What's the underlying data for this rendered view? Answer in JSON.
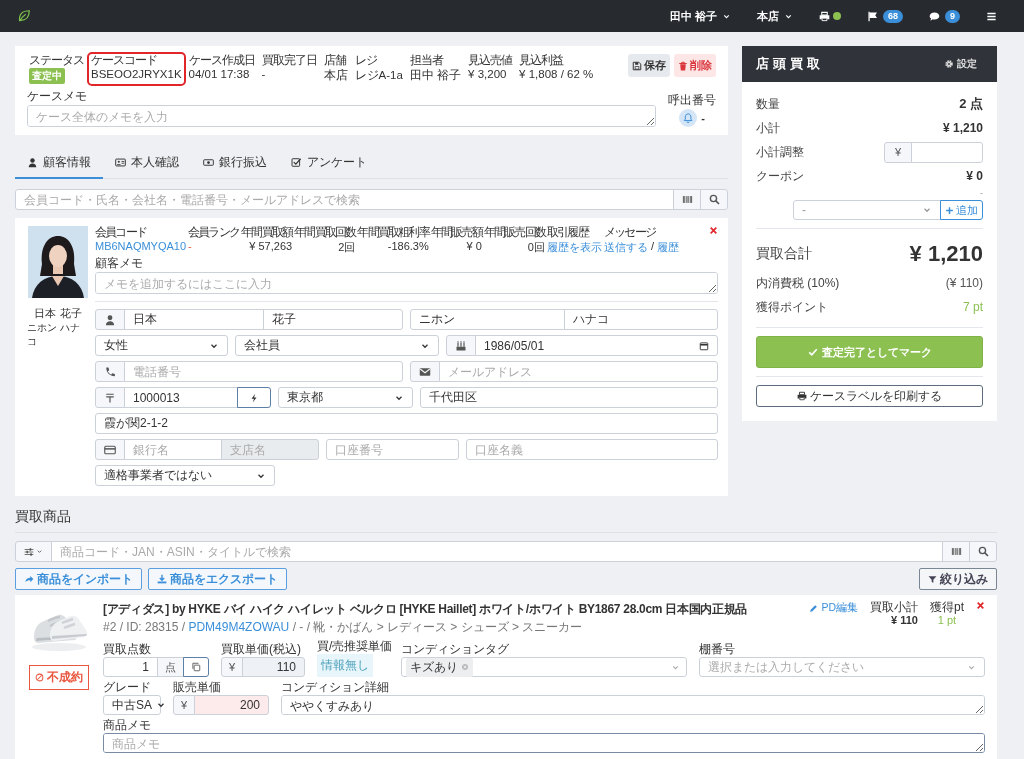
{
  "topbar": {
    "user": "田中 裕子",
    "store": "本店",
    "printer_online": true,
    "flags": "68",
    "messages": "9"
  },
  "case": {
    "fields": [
      {
        "label": "ステータス",
        "value": "査定中",
        "kind": "badge",
        "highlighted": false
      },
      {
        "label": "ケースコード",
        "value": "BSEOO2JRYX1K",
        "kind": "text",
        "highlighted": true
      },
      {
        "label": "ケース作成日",
        "value": "04/01 17:38",
        "kind": "text",
        "highlighted": false
      },
      {
        "label": "買取完了日",
        "value": "-",
        "kind": "text",
        "highlighted": false
      },
      {
        "label": "店舗",
        "value": "本店",
        "kind": "text",
        "highlighted": false
      },
      {
        "label": "レジ",
        "value": "レジA-1a",
        "kind": "text",
        "highlighted": false
      },
      {
        "label": "担当者",
        "value": "田中 裕子",
        "kind": "text",
        "highlighted": false
      },
      {
        "label": "見込売値",
        "value": "¥ 3,200",
        "kind": "text",
        "highlighted": false
      },
      {
        "label": "見込利益",
        "value": "¥ 1,808 / 62 %",
        "kind": "text",
        "highlighted": false
      }
    ],
    "save": "保存",
    "delete": "削除",
    "memo": {
      "label": "ケースメモ",
      "placeholder": "ケース全体のメモを入力"
    },
    "call_number": {
      "label": "呼出番号",
      "value": "-"
    }
  },
  "tabs": [
    {
      "label": "顧客情報",
      "selected": true
    },
    {
      "label": "本人確認",
      "selected": false
    },
    {
      "label": "銀行振込",
      "selected": false
    },
    {
      "label": "アンケート",
      "selected": false
    }
  ],
  "customer_search": {
    "placeholder": "会員コード・氏名・会社名・電話番号・メールアドレスで検索"
  },
  "customer": {
    "name": "日本 花子",
    "kana": "ニホン ハナコ",
    "stats": [
      {
        "label": "会員コード",
        "value": "MB6NAQMYQA10",
        "kind": "link"
      },
      {
        "label": "会員ランク",
        "value": "-",
        "kind": "alert"
      },
      {
        "label": "年間買取額",
        "value": "¥ 57,263",
        "kind": "number"
      },
      {
        "label": "年間買取回数",
        "value": "2回",
        "kind": "number"
      },
      {
        "label": "年間買取粗利率",
        "value": "-186.3%",
        "kind": "number"
      },
      {
        "label": "年間販売額",
        "value": "¥ 0",
        "kind": "number"
      },
      {
        "label": "年間販売回数",
        "value": "0回",
        "kind": "number"
      },
      {
        "label": "取引履歴",
        "value": "履歴を表示",
        "kind": "link"
      },
      {
        "label": "メッセージ",
        "links": [
          "送信する",
          "履歴"
        ],
        "separator": "/",
        "kind": "links"
      }
    ],
    "memo": {
      "label": "顧客メモ",
      "placeholder": "メモを追加するにはここに入力"
    },
    "form": {
      "last_name": "日本",
      "first_name": "花子",
      "last_kana": "ニホン",
      "first_kana": "ハナコ",
      "gender": "女性",
      "occupation": "会社員",
      "birthday": "1986/05/01",
      "phone": {
        "placeholder": "電話番号"
      },
      "email": {
        "placeholder": "メールアドレス"
      },
      "postal_code": "1000013",
      "prefecture": "東京都",
      "city": "千代田区",
      "address": "霞が関2-1-2",
      "bank_name": {
        "placeholder": "銀行名",
        "disabled": false
      },
      "branch_name": {
        "placeholder": "支店名",
        "disabled": true
      },
      "account_number": {
        "placeholder": "口座番号",
        "disabled": false
      },
      "account_holder": {
        "placeholder": "口座名義",
        "disabled": false
      },
      "invoice_status": "適格事業者ではない"
    }
  },
  "summary": {
    "title": "店頭買取",
    "settings": "設定",
    "quantity": {
      "label": "数量",
      "value": "2 点"
    },
    "subtotal": {
      "label": "小計",
      "value": "¥ 1,210"
    },
    "adjustment": {
      "label": "小計調整",
      "currency": "¥"
    },
    "coupon": {
      "label": "クーポン",
      "value": "¥ 0",
      "note": "-",
      "select": "-",
      "add": "追加"
    },
    "total": {
      "label": "買取合計",
      "value": "¥ 1,210"
    },
    "tax": {
      "label": "内消費税 (10%)",
      "value": "(¥ 110)"
    },
    "points": {
      "label": "獲得ポイント",
      "value": "7 pt"
    },
    "complete": "査定完了としてマーク",
    "print": "ケースラベルを印刷する"
  },
  "products": {
    "title": "買取商品",
    "search_placeholder": "商品コード・JAN・ASIN・タイトルで検索",
    "import": "商品をインポート",
    "export": "商品をエクスポート",
    "filter": "絞り込み",
    "items": [
      {
        "kind": "picture",
        "status": "不成約",
        "title": "[アディダス] by HYKE バイ ハイク ハイレット ベルクロ [HYKE Haillet] ホワイト/ホワイト BY1867 28.0cm 日本国内正規品",
        "meta_before": "#2 / ID: 28315 /",
        "code": "PDM49M4ZOWAU",
        "meta_after": "/ - / 靴・かばん > レディース > シューズ > スニーカー",
        "edit": "PD編集",
        "subtotal_label": "買取小計",
        "subtotal": "¥ 110",
        "points_label": "獲得pt",
        "points": "1 pt",
        "quantity_label": "買取点数",
        "quantity": "1",
        "unit": "点",
        "price_label": "買取単価(税込)",
        "currency": "¥",
        "price": "110",
        "recommended_label": "買/売推奨単価",
        "recommended": "情報無し",
        "tags_label": "コンディションタグ",
        "tags": [
          "キズあり"
        ],
        "shelf_label": "棚番号",
        "shelf_placeholder": "選択または入力してください",
        "grade_label": "グレード",
        "grade": "中古SA",
        "sale_price_label": "販売単価",
        "sale_currency": "¥",
        "sale_price": "200",
        "condition_label": "コンディション詳細",
        "condition": "ややくすみあり",
        "memo_label": "商品メモ",
        "memo_placeholder": "商品メモ"
      }
    ]
  }
}
